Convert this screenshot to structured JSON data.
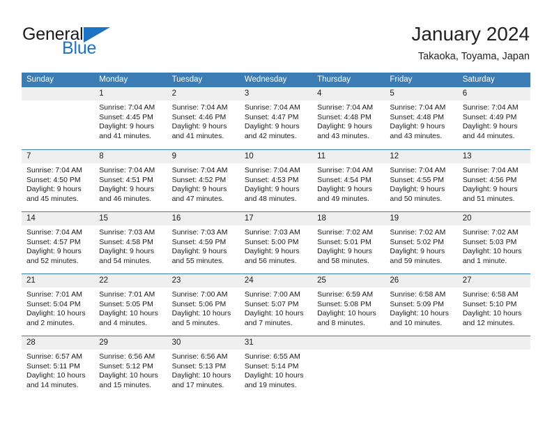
{
  "brand": {
    "line1": "General",
    "line2": "Blue",
    "accent_color": "#1c72c4"
  },
  "header": {
    "title": "January 2024",
    "subtitle": "Takaoka, Toyama, Japan"
  },
  "theme": {
    "header_blue": "#3b7cb5",
    "daynum_background": "#efefef",
    "text": "#1a1a1a"
  },
  "weekday_headers": [
    "Sunday",
    "Monday",
    "Tuesday",
    "Wednesday",
    "Thursday",
    "Friday",
    "Saturday"
  ],
  "weeks": [
    [
      {
        "day": "",
        "sunrise": "",
        "sunset": "",
        "daylight_line1": "",
        "daylight_line2": ""
      },
      {
        "day": "1",
        "sunrise": "Sunrise: 7:04 AM",
        "sunset": "Sunset: 4:45 PM",
        "daylight_line1": "Daylight: 9 hours",
        "daylight_line2": "and 41 minutes."
      },
      {
        "day": "2",
        "sunrise": "Sunrise: 7:04 AM",
        "sunset": "Sunset: 4:46 PM",
        "daylight_line1": "Daylight: 9 hours",
        "daylight_line2": "and 41 minutes."
      },
      {
        "day": "3",
        "sunrise": "Sunrise: 7:04 AM",
        "sunset": "Sunset: 4:47 PM",
        "daylight_line1": "Daylight: 9 hours",
        "daylight_line2": "and 42 minutes."
      },
      {
        "day": "4",
        "sunrise": "Sunrise: 7:04 AM",
        "sunset": "Sunset: 4:48 PM",
        "daylight_line1": "Daylight: 9 hours",
        "daylight_line2": "and 43 minutes."
      },
      {
        "day": "5",
        "sunrise": "Sunrise: 7:04 AM",
        "sunset": "Sunset: 4:48 PM",
        "daylight_line1": "Daylight: 9 hours",
        "daylight_line2": "and 43 minutes."
      },
      {
        "day": "6",
        "sunrise": "Sunrise: 7:04 AM",
        "sunset": "Sunset: 4:49 PM",
        "daylight_line1": "Daylight: 9 hours",
        "daylight_line2": "and 44 minutes."
      }
    ],
    [
      {
        "day": "7",
        "sunrise": "Sunrise: 7:04 AM",
        "sunset": "Sunset: 4:50 PM",
        "daylight_line1": "Daylight: 9 hours",
        "daylight_line2": "and 45 minutes."
      },
      {
        "day": "8",
        "sunrise": "Sunrise: 7:04 AM",
        "sunset": "Sunset: 4:51 PM",
        "daylight_line1": "Daylight: 9 hours",
        "daylight_line2": "and 46 minutes."
      },
      {
        "day": "9",
        "sunrise": "Sunrise: 7:04 AM",
        "sunset": "Sunset: 4:52 PM",
        "daylight_line1": "Daylight: 9 hours",
        "daylight_line2": "and 47 minutes."
      },
      {
        "day": "10",
        "sunrise": "Sunrise: 7:04 AM",
        "sunset": "Sunset: 4:53 PM",
        "daylight_line1": "Daylight: 9 hours",
        "daylight_line2": "and 48 minutes."
      },
      {
        "day": "11",
        "sunrise": "Sunrise: 7:04 AM",
        "sunset": "Sunset: 4:54 PM",
        "daylight_line1": "Daylight: 9 hours",
        "daylight_line2": "and 49 minutes."
      },
      {
        "day": "12",
        "sunrise": "Sunrise: 7:04 AM",
        "sunset": "Sunset: 4:55 PM",
        "daylight_line1": "Daylight: 9 hours",
        "daylight_line2": "and 50 minutes."
      },
      {
        "day": "13",
        "sunrise": "Sunrise: 7:04 AM",
        "sunset": "Sunset: 4:56 PM",
        "daylight_line1": "Daylight: 9 hours",
        "daylight_line2": "and 51 minutes."
      }
    ],
    [
      {
        "day": "14",
        "sunrise": "Sunrise: 7:04 AM",
        "sunset": "Sunset: 4:57 PM",
        "daylight_line1": "Daylight: 9 hours",
        "daylight_line2": "and 52 minutes."
      },
      {
        "day": "15",
        "sunrise": "Sunrise: 7:03 AM",
        "sunset": "Sunset: 4:58 PM",
        "daylight_line1": "Daylight: 9 hours",
        "daylight_line2": "and 54 minutes."
      },
      {
        "day": "16",
        "sunrise": "Sunrise: 7:03 AM",
        "sunset": "Sunset: 4:59 PM",
        "daylight_line1": "Daylight: 9 hours",
        "daylight_line2": "and 55 minutes."
      },
      {
        "day": "17",
        "sunrise": "Sunrise: 7:03 AM",
        "sunset": "Sunset: 5:00 PM",
        "daylight_line1": "Daylight: 9 hours",
        "daylight_line2": "and 56 minutes."
      },
      {
        "day": "18",
        "sunrise": "Sunrise: 7:02 AM",
        "sunset": "Sunset: 5:01 PM",
        "daylight_line1": "Daylight: 9 hours",
        "daylight_line2": "and 58 minutes."
      },
      {
        "day": "19",
        "sunrise": "Sunrise: 7:02 AM",
        "sunset": "Sunset: 5:02 PM",
        "daylight_line1": "Daylight: 9 hours",
        "daylight_line2": "and 59 minutes."
      },
      {
        "day": "20",
        "sunrise": "Sunrise: 7:02 AM",
        "sunset": "Sunset: 5:03 PM",
        "daylight_line1": "Daylight: 10 hours",
        "daylight_line2": "and 1 minute."
      }
    ],
    [
      {
        "day": "21",
        "sunrise": "Sunrise: 7:01 AM",
        "sunset": "Sunset: 5:04 PM",
        "daylight_line1": "Daylight: 10 hours",
        "daylight_line2": "and 2 minutes."
      },
      {
        "day": "22",
        "sunrise": "Sunrise: 7:01 AM",
        "sunset": "Sunset: 5:05 PM",
        "daylight_line1": "Daylight: 10 hours",
        "daylight_line2": "and 4 minutes."
      },
      {
        "day": "23",
        "sunrise": "Sunrise: 7:00 AM",
        "sunset": "Sunset: 5:06 PM",
        "daylight_line1": "Daylight: 10 hours",
        "daylight_line2": "and 5 minutes."
      },
      {
        "day": "24",
        "sunrise": "Sunrise: 7:00 AM",
        "sunset": "Sunset: 5:07 PM",
        "daylight_line1": "Daylight: 10 hours",
        "daylight_line2": "and 7 minutes."
      },
      {
        "day": "25",
        "sunrise": "Sunrise: 6:59 AM",
        "sunset": "Sunset: 5:08 PM",
        "daylight_line1": "Daylight: 10 hours",
        "daylight_line2": "and 8 minutes."
      },
      {
        "day": "26",
        "sunrise": "Sunrise: 6:58 AM",
        "sunset": "Sunset: 5:09 PM",
        "daylight_line1": "Daylight: 10 hours",
        "daylight_line2": "and 10 minutes."
      },
      {
        "day": "27",
        "sunrise": "Sunrise: 6:58 AM",
        "sunset": "Sunset: 5:10 PM",
        "daylight_line1": "Daylight: 10 hours",
        "daylight_line2": "and 12 minutes."
      }
    ],
    [
      {
        "day": "28",
        "sunrise": "Sunrise: 6:57 AM",
        "sunset": "Sunset: 5:11 PM",
        "daylight_line1": "Daylight: 10 hours",
        "daylight_line2": "and 14 minutes."
      },
      {
        "day": "29",
        "sunrise": "Sunrise: 6:56 AM",
        "sunset": "Sunset: 5:12 PM",
        "daylight_line1": "Daylight: 10 hours",
        "daylight_line2": "and 15 minutes."
      },
      {
        "day": "30",
        "sunrise": "Sunrise: 6:56 AM",
        "sunset": "Sunset: 5:13 PM",
        "daylight_line1": "Daylight: 10 hours",
        "daylight_line2": "and 17 minutes."
      },
      {
        "day": "31",
        "sunrise": "Sunrise: 6:55 AM",
        "sunset": "Sunset: 5:14 PM",
        "daylight_line1": "Daylight: 10 hours",
        "daylight_line2": "and 19 minutes."
      },
      {
        "day": "",
        "sunrise": "",
        "sunset": "",
        "daylight_line1": "",
        "daylight_line2": ""
      },
      {
        "day": "",
        "sunrise": "",
        "sunset": "",
        "daylight_line1": "",
        "daylight_line2": ""
      },
      {
        "day": "",
        "sunrise": "",
        "sunset": "",
        "daylight_line1": "",
        "daylight_line2": ""
      }
    ]
  ]
}
